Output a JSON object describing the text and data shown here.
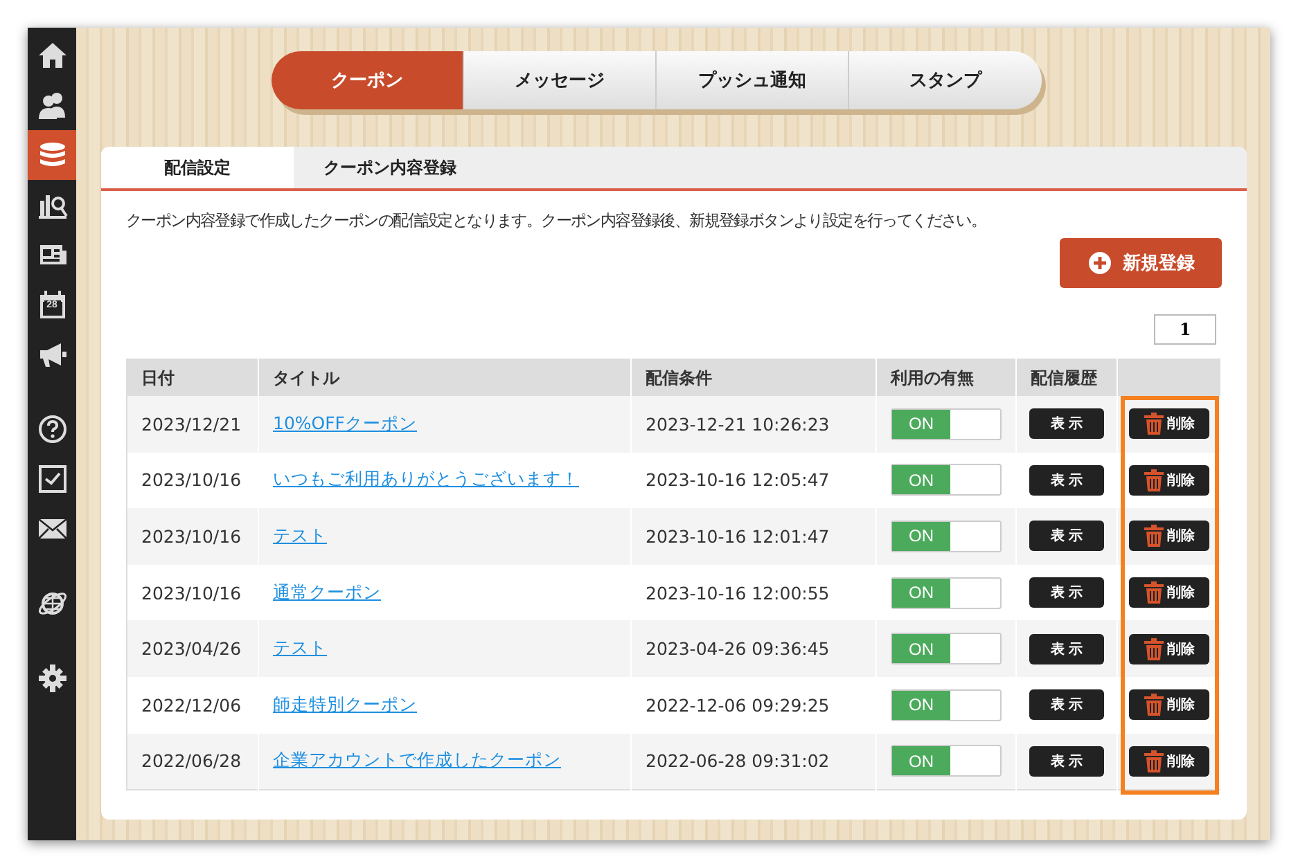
{
  "sidebar": {
    "items": [
      {
        "selected": false
      },
      {
        "selected": false
      },
      {
        "selected": true
      },
      {
        "selected": false
      },
      {
        "selected": false
      },
      {
        "selected": false,
        "badge": "28"
      },
      {
        "selected": false
      },
      {
        "selected": false
      },
      {
        "selected": false
      },
      {
        "selected": false
      },
      {
        "selected": false
      },
      {
        "selected": false
      }
    ]
  },
  "main_tabs": [
    {
      "label": "クーポン",
      "selected": true
    },
    {
      "label": "メッセージ",
      "selected": false
    },
    {
      "label": "プッシュ通知",
      "selected": false
    },
    {
      "label": "スタンプ",
      "selected": false
    }
  ],
  "sub_tabs": [
    {
      "label": "配信設定",
      "selected": true
    },
    {
      "label": "クーポン内容登録",
      "selected": false
    }
  ],
  "description": "クーポン内容登録で作成したクーポンの配信設定となります。クーポン内容登録後、新規登録ボタンより設定を行ってください。",
  "new_button": "新規登録",
  "pager": [
    "1"
  ],
  "table": {
    "columns": [
      "日付",
      "タイトル",
      "配信条件",
      "利用の有無",
      "配信履歴"
    ],
    "rows": [
      {
        "date": "2023/12/21",
        "title": "10%OFFクーポン",
        "condition": "2023-12-21 10:26:23",
        "toggle": {
          "label": "ON",
          "on": true
        },
        "view": "表 示",
        "delete": "削除"
      },
      {
        "date": "2023/10/16",
        "title": "いつもご利用ありがとうございます！",
        "condition": "2023-10-16 12:05:47",
        "toggle": {
          "label": "ON",
          "on": true
        },
        "view": "表 示",
        "delete": "削除"
      },
      {
        "date": "2023/10/16",
        "title": "テスト",
        "condition": "2023-10-16 12:01:47",
        "toggle": {
          "label": "ON",
          "on": true
        },
        "view": "表 示",
        "delete": "削除"
      },
      {
        "date": "2023/10/16",
        "title": "通常クーポン",
        "condition": "2023-10-16 12:00:55",
        "toggle": {
          "label": "ON",
          "on": true
        },
        "view": "表 示",
        "delete": "削除"
      },
      {
        "date": "2023/04/26",
        "title": "テスト",
        "condition": "2023-04-26 09:36:45",
        "toggle": {
          "label": "ON",
          "on": true
        },
        "view": "表 示",
        "delete": "削除"
      },
      {
        "date": "2022/12/06",
        "title": "師走特別クーポン",
        "condition": "2022-12-06 09:29:25",
        "toggle": {
          "label": "ON",
          "on": true
        },
        "view": "表 示",
        "delete": "削除"
      },
      {
        "date": "2022/06/28",
        "title": "企業アカウントで作成したクーポン",
        "condition": "2022-06-28 09:31:02",
        "toggle": {
          "label": "ON",
          "on": true
        },
        "view": "表 示",
        "delete": "削除"
      }
    ]
  },
  "highlight": {
    "shown": true
  }
}
